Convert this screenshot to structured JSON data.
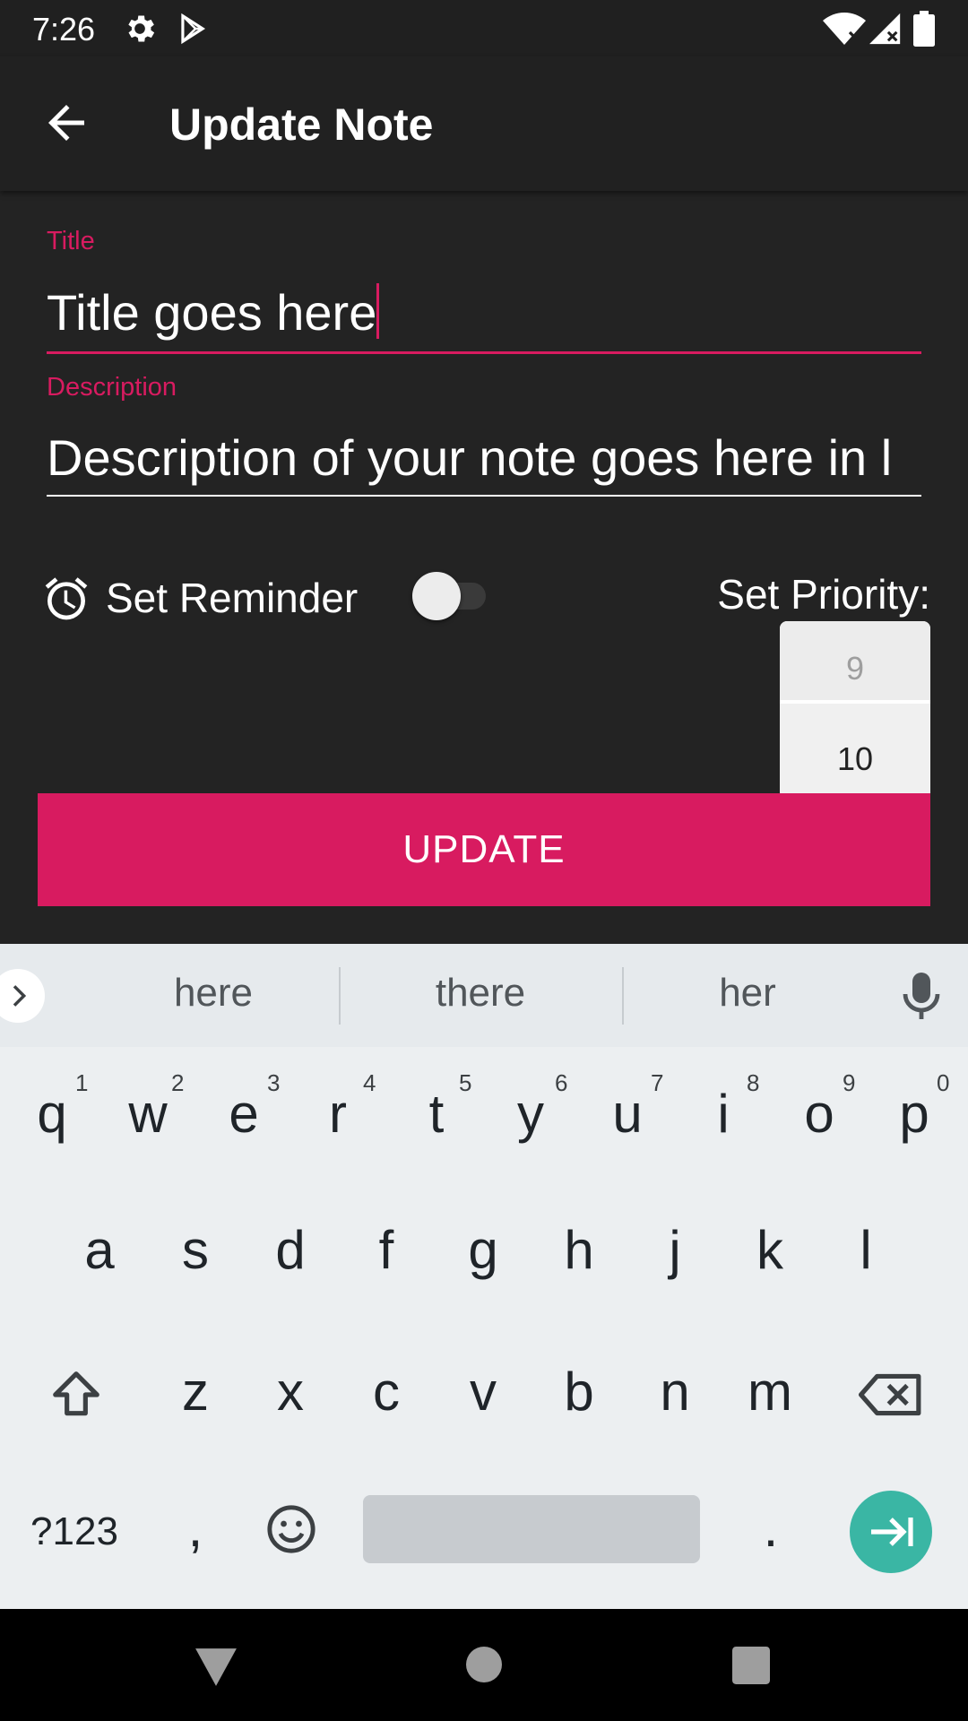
{
  "status_bar": {
    "time": "7:26",
    "icons": [
      "gear-icon",
      "play-store-icon",
      "wifi-icon",
      "signal-icon",
      "battery-icon"
    ]
  },
  "app_bar": {
    "title": "Update Note",
    "back_icon": "arrow-back-icon"
  },
  "form": {
    "title_label": "Title",
    "title_value": "Title goes here",
    "description_label": "Description",
    "description_value": "Description of your note goes here in l",
    "reminder_label": "Set Reminder",
    "reminder_on": false,
    "priority_label": "Set Priority:",
    "priority_options": [
      "9",
      "10"
    ],
    "update_button": "UPDATE"
  },
  "keyboard": {
    "suggestions": [
      "here",
      "there",
      "her"
    ],
    "row1": [
      "q",
      "w",
      "e",
      "r",
      "t",
      "y",
      "u",
      "i",
      "o",
      "p"
    ],
    "row1_hints": [
      "1",
      "2",
      "3",
      "4",
      "5",
      "6",
      "7",
      "8",
      "9",
      "0"
    ],
    "row2": [
      "a",
      "s",
      "d",
      "f",
      "g",
      "h",
      "j",
      "k",
      "l"
    ],
    "row3": [
      "z",
      "x",
      "c",
      "v",
      "b",
      "n",
      "m"
    ],
    "symbols_key": "?123",
    "comma_key": ",",
    "period_key": "."
  },
  "colors": {
    "accent": "#d81b60",
    "background": "#232323",
    "enter_key": "#3ab6a4"
  }
}
